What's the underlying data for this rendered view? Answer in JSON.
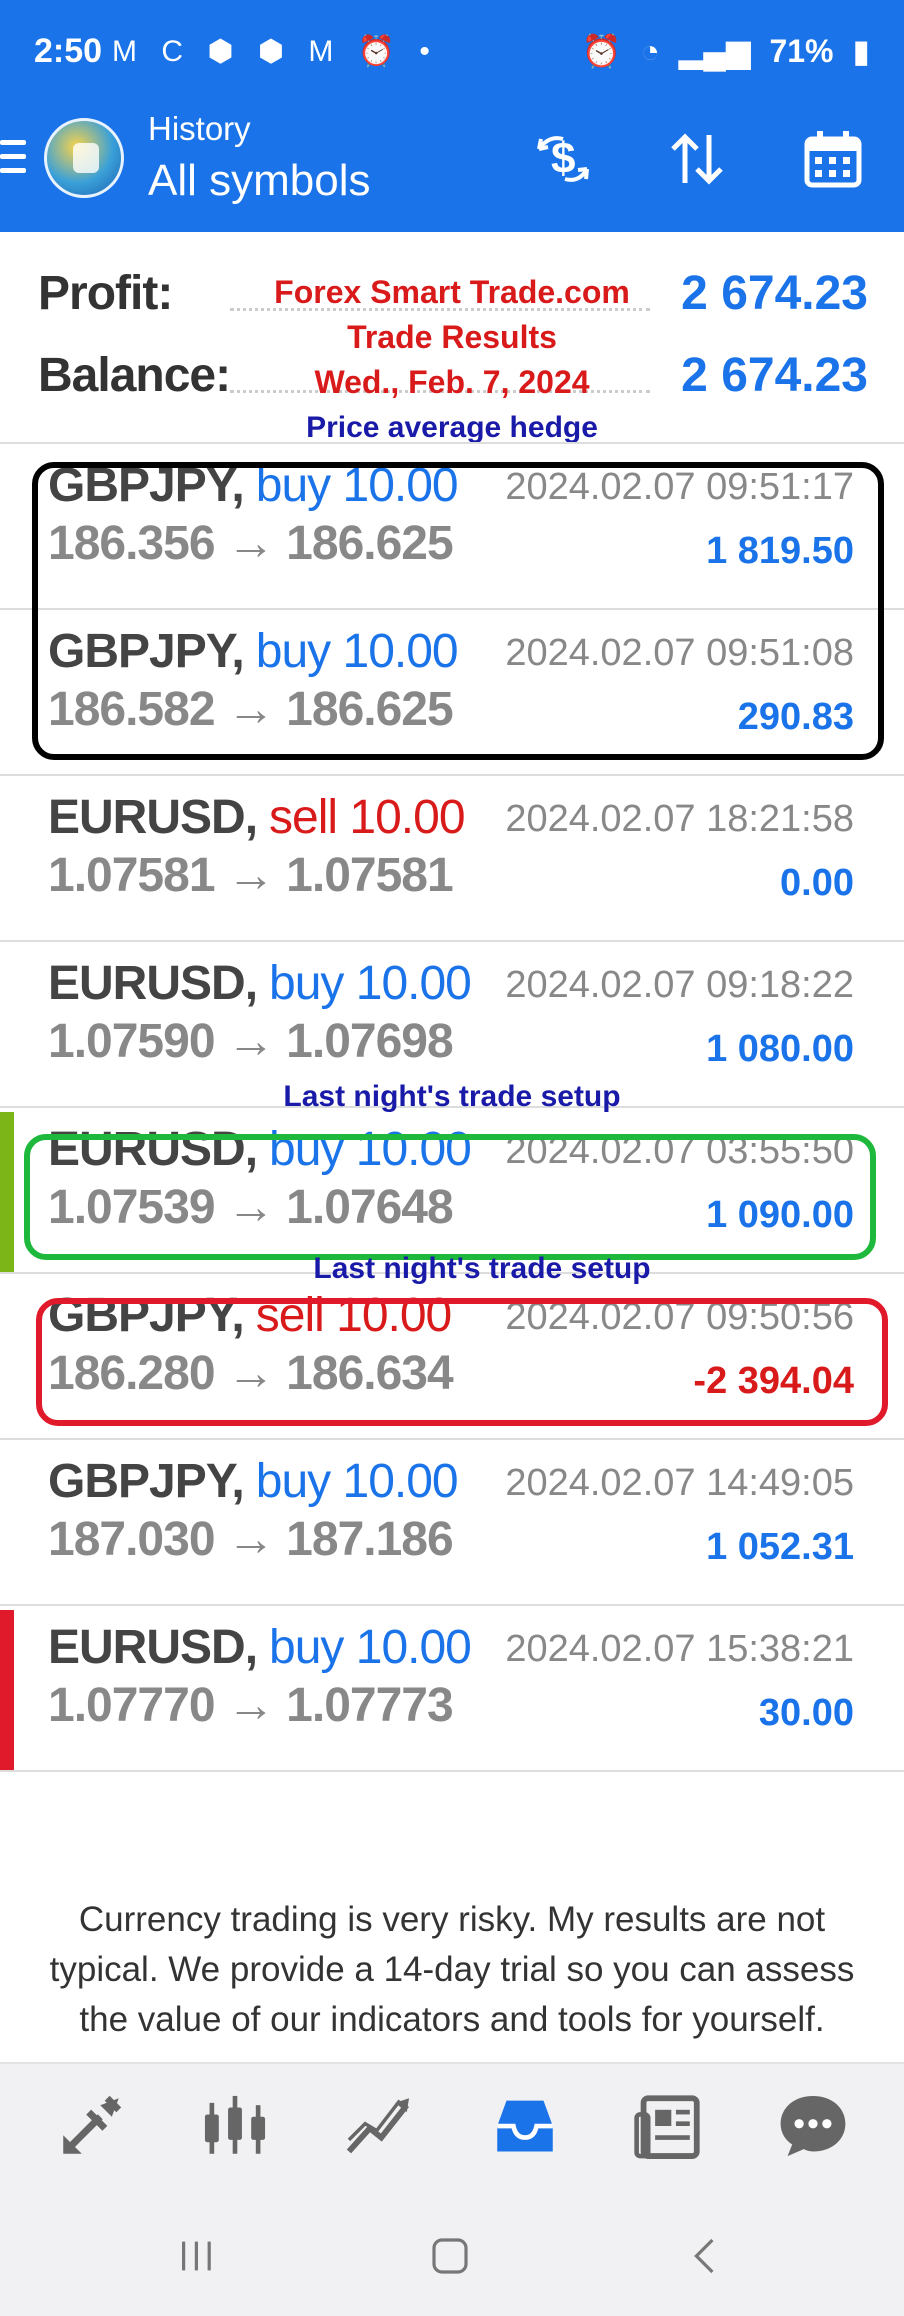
{
  "status_bar": {
    "time": "2:50",
    "notification_icons": "M C ⬢ ⬢ M ⏰ •",
    "alarm": "⏰",
    "signal": "▂▄▆",
    "battery": "71%"
  },
  "header": {
    "subtitle": "History",
    "title": "All symbols",
    "icons": [
      "dollar-exchange-icon",
      "sort-icon",
      "calendar-icon"
    ]
  },
  "summary": {
    "profit_label": "Profit:",
    "profit_value": "2 674.23",
    "balance_label": "Balance:",
    "balance_value": "2 674.23"
  },
  "promo": {
    "line1": "Forex Smart Trade.com",
    "line2": "Trade Results",
    "line3": "Wed., Feb. 7, 2024",
    "line4": "Price average hedge"
  },
  "trades": [
    {
      "symbol": "GBPJPY,",
      "side": "buy 10.00",
      "side_type": "buy",
      "prices": "186.356 → 186.625",
      "date": "2024.02.07 09:51:17",
      "pnl": "1 819.50"
    },
    {
      "symbol": "GBPJPY,",
      "side": "buy 10.00",
      "side_type": "buy",
      "prices": "186.582 → 186.625",
      "date": "2024.02.07 09:51:08",
      "pnl": "290.83"
    },
    {
      "symbol": "EURUSD,",
      "side": "sell 10.00",
      "side_type": "sell",
      "prices": "1.07581 → 1.07581",
      "date": "2024.02.07 18:21:58",
      "pnl": "0.00"
    },
    {
      "symbol": "EURUSD,",
      "side": "buy 10.00",
      "side_type": "buy",
      "prices": "1.07590 → 1.07698",
      "date": "2024.02.07 09:18:22",
      "pnl": "1 080.00"
    },
    {
      "symbol": "EURUSD,",
      "side": "buy 10.00",
      "side_type": "buy",
      "prices": "1.07539 → 1.07648",
      "date": "2024.02.07 03:55:50",
      "pnl": "1 090.00"
    },
    {
      "symbol": "GBPJPY,",
      "side": "sell 10.00",
      "side_type": "sell",
      "prices": "186.280 → 186.634",
      "date": "2024.02.07 09:50:56",
      "pnl": "-2 394.04"
    },
    {
      "symbol": "GBPJPY,",
      "side": "buy 10.00",
      "side_type": "buy",
      "prices": "187.030 → 187.186",
      "date": "2024.02.07 14:49:05",
      "pnl": "1 052.31"
    },
    {
      "symbol": "EURUSD,",
      "side": "buy 10.00",
      "side_type": "buy",
      "prices": "1.07770 → 1.07773",
      "date": "2024.02.07 15:38:21",
      "pnl": "30.00"
    }
  ],
  "annotations": {
    "setup1": "Last night's trade setup",
    "setup2": "Last night's trade setup"
  },
  "disclaimer": "Currency trading is very risky. My results are not typical. We provide a 14-day trial so you can assess the value of our indicators and tools for yourself.",
  "bottom_nav": [
    "trade-icon",
    "chart-icon",
    "analytics-icon",
    "history-icon",
    "news-icon",
    "chat-icon"
  ],
  "colors": {
    "accent": "#1a73e8",
    "loss": "#d91a1a",
    "annotation_blue": "#1a1aa8",
    "box_black": "#000000",
    "box_green": "#1db83c",
    "box_red": "#e01a2a",
    "flag_green": "#7cb518",
    "flag_red": "#e01a2a"
  }
}
